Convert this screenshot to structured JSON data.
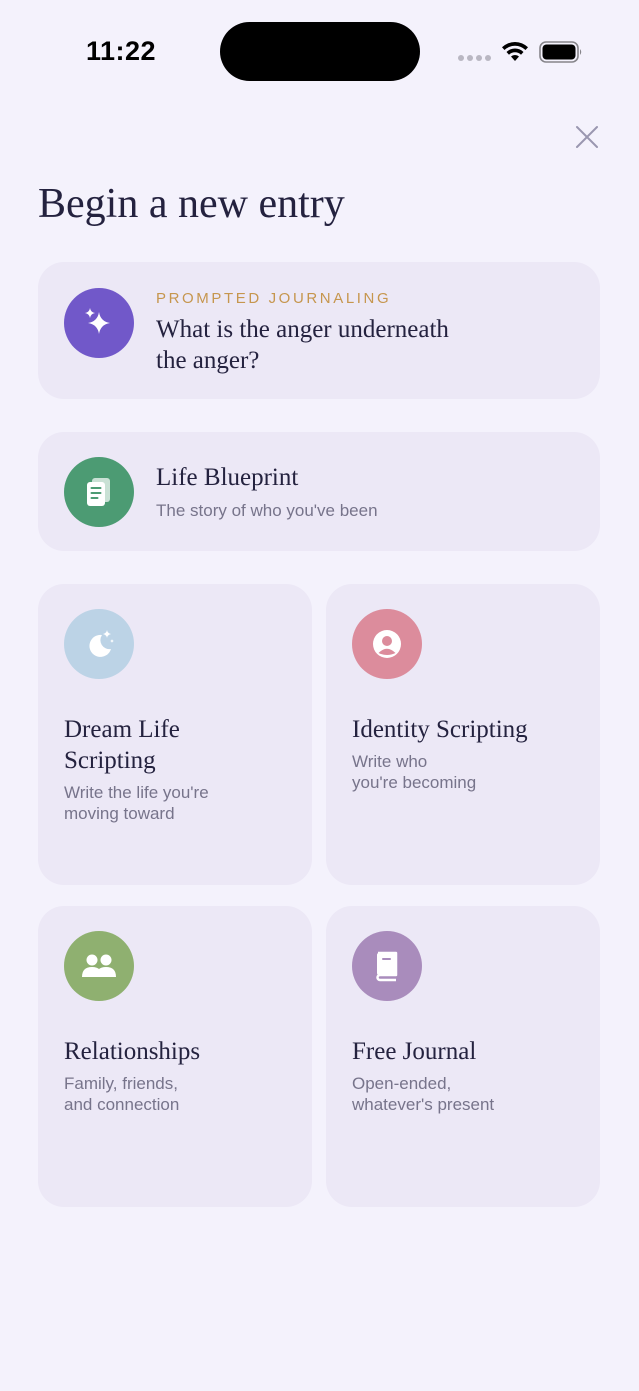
{
  "status_bar": {
    "time": "11:22"
  },
  "header": {
    "title": "Begin a new entry"
  },
  "prompt_card": {
    "eyebrow": "PROMPTED JOURNALING",
    "prompt": "What is the anger underneath\nthe anger?",
    "icon": "sparkles-icon",
    "icon_color": "#7158c9"
  },
  "blueprint_card": {
    "title": "Life Blueprint",
    "subtitle": "The story of who you've been",
    "icon": "document-icon",
    "icon_color": "#4c9b73"
  },
  "grid_cards": [
    {
      "title": "Dream Life\nScripting",
      "subtitle": "Write the life you're\nmoving toward",
      "icon": "moon-stars-icon",
      "icon_color": "#bcd3e6"
    },
    {
      "title": "Identity Scripting",
      "subtitle": "Write who\nyou're becoming",
      "icon": "person-circle-icon",
      "icon_color": "#dc8c9c"
    },
    {
      "title": "Relationships",
      "subtitle": "Family, friends,\nand connection",
      "icon": "people-icon",
      "icon_color": "#8fb070"
    },
    {
      "title": "Free Journal",
      "subtitle": "Open-ended,\nwhatever's present",
      "icon": "book-icon",
      "icon_color": "#a98cbc"
    }
  ]
}
